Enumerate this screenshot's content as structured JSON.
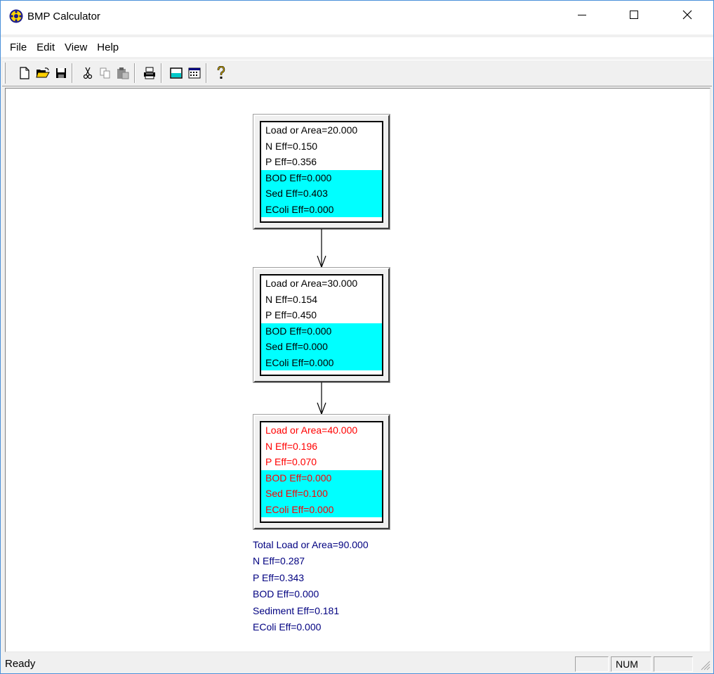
{
  "app": {
    "title": "BMP Calculator",
    "icon": "bmp-calculator-app-icon"
  },
  "window_controls": {
    "minimize": "minimize-icon",
    "maximize": "maximize-icon",
    "close": "close-icon"
  },
  "menu": {
    "items": [
      {
        "label": "File"
      },
      {
        "label": "Edit"
      },
      {
        "label": "View"
      },
      {
        "label": "Help"
      }
    ]
  },
  "toolbar": {
    "buttons": [
      "new-file-icon",
      "open-folder-icon",
      "save-disk-icon",
      "cut-scissors-icon",
      "copy-icon",
      "paste-icon",
      "print-icon",
      "properties-window-icon",
      "calendar-grid-icon",
      "help-question-icon"
    ]
  },
  "bmps": [
    {
      "load": "Load or Area=20.000",
      "n_eff": "N Eff=0.150",
      "p_eff": "P Eff=0.356",
      "bod_eff": "BOD Eff=0.000",
      "sed_eff": "Sed Eff=0.403",
      "ecoli_eff": "EColi Eff=0.000",
      "selected": false
    },
    {
      "load": "Load or Area=30.000",
      "n_eff": "N Eff=0.154",
      "p_eff": "P Eff=0.450",
      "bod_eff": "BOD Eff=0.000",
      "sed_eff": "Sed Eff=0.000",
      "ecoli_eff": "EColi Eff=0.000",
      "selected": false
    },
    {
      "load": "Load or Area=40.000",
      "n_eff": "N Eff=0.196",
      "p_eff": "P Eff=0.070",
      "bod_eff": "BOD Eff=0.000",
      "sed_eff": "Sed Eff=0.100",
      "ecoli_eff": "EColi Eff=0.000",
      "selected": true
    }
  ],
  "totals": {
    "load": "Total Load or Area=90.000",
    "n_eff": "N Eff=0.287",
    "p_eff": "P Eff=0.343",
    "bod_eff": "BOD Eff=0.000",
    "sed_eff": "Sediment Eff=0.181",
    "ecoli_eff": "EColi Eff=0.000"
  },
  "status": {
    "text": "Ready",
    "pane1": "",
    "num": "NUM",
    "pane3": ""
  },
  "colors": {
    "cyan_fill": "#00ffff",
    "selected_text": "#ff0000",
    "totals_text": "#000080"
  }
}
